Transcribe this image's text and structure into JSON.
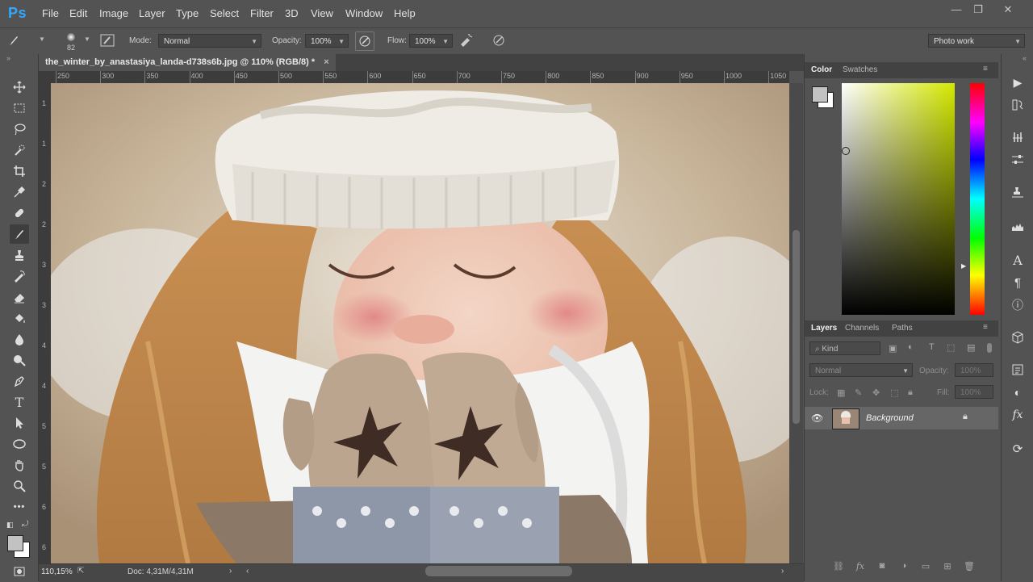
{
  "app": {
    "logo": "Ps"
  },
  "menu": [
    "File",
    "Edit",
    "Image",
    "Layer",
    "Type",
    "Select",
    "Filter",
    "3D",
    "View",
    "Window",
    "Help"
  ],
  "options": {
    "brush_size": "82",
    "mode_label": "Mode:",
    "mode_value": "Normal",
    "opacity_label": "Opacity:",
    "opacity_value": "100%",
    "flow_label": "Flow:",
    "flow_value": "100%",
    "workspace": "Photo work"
  },
  "document": {
    "tab_title": "the_winter_by_anastasiya_landa-d738s6b.jpg @ 110% (RGB/8) *",
    "close": "×"
  },
  "ruler": {
    "h_ticks": [
      "250",
      "300",
      "350",
      "400",
      "450",
      "500",
      "550",
      "600",
      "650",
      "700",
      "750",
      "800",
      "850",
      "900",
      "950",
      "1000",
      "1050"
    ],
    "v_ticks": [
      "1",
      "1",
      "2",
      "2",
      "3",
      "3",
      "4",
      "4",
      "5",
      "5",
      "6",
      "6"
    ]
  },
  "status": {
    "zoom": "110,15%",
    "doc": "Doc: 4,31M/4,31M"
  },
  "color_panel": {
    "tabs": [
      "Color",
      "Swatches"
    ],
    "foreground": "#c2c2c2",
    "background": "#ffffff"
  },
  "layers_panel": {
    "tabs": [
      "Layers",
      "Channels",
      "Paths"
    ],
    "kind_placeholder": "Kind",
    "blend_mode": "Normal",
    "opacity_label": "Opacity:",
    "opacity_value": "100%",
    "lock_label": "Lock:",
    "fill_label": "Fill:",
    "fill_value": "100%",
    "layers": [
      {
        "name": "Background",
        "visible": true,
        "locked": true
      }
    ]
  },
  "colors": {
    "accent": "#31a8ff",
    "panel": "#535353",
    "dark": "#424242"
  }
}
